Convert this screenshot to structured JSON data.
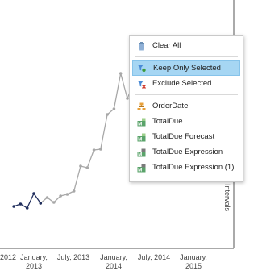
{
  "chart_data": {
    "type": "line",
    "x_ticks": [
      {
        "lines": [
          "2012"
        ]
      },
      {
        "lines": [
          "January,",
          "2013"
        ]
      },
      {
        "lines": [
          "July, 2013"
        ]
      },
      {
        "lines": [
          "January,",
          "2014"
        ]
      },
      {
        "lines": [
          "July, 2014"
        ]
      },
      {
        "lines": [
          "January,",
          "2015"
        ]
      }
    ],
    "side_label": "Intervals",
    "series_selected": [
      {
        "x": "2012-10",
        "y": 11.2
      },
      {
        "x": "2012-11",
        "y": 11.5
      },
      {
        "x": "2012-12",
        "y": 11.0
      },
      {
        "x": "2013-01",
        "y": 12.8
      },
      {
        "x": "2013-02",
        "y": 11.6
      }
    ],
    "series_other": [
      {
        "x": "2013-02",
        "y": 11.6
      },
      {
        "x": "2013-03",
        "y": 12.3
      },
      {
        "x": "2013-04",
        "y": 11.7
      },
      {
        "x": "2013-05",
        "y": 12.5
      },
      {
        "x": "2013-06",
        "y": 12.7
      },
      {
        "x": "2013-07",
        "y": 13.1
      },
      {
        "x": "2013-08",
        "y": 16.2
      },
      {
        "x": "2013-09",
        "y": 16.0
      },
      {
        "x": "2013-10",
        "y": 18.2
      },
      {
        "x": "2013-11",
        "y": 18.3
      },
      {
        "x": "2013-12",
        "y": 22.6
      },
      {
        "x": "2014-01",
        "y": 23.3
      },
      {
        "x": "2014-02",
        "y": 27.7
      },
      {
        "x": "2014-03",
        "y": 24.6
      },
      {
        "x": "2014-04",
        "y": 26.6
      },
      {
        "x": "2014-05",
        "y": 24.3
      },
      {
        "x": "2014-06",
        "y": 28.0
      }
    ],
    "colors": {
      "selected": "#1f2d5c",
      "other": "#a8a8a8",
      "axis": "#555555"
    }
  },
  "context_menu": {
    "items": [
      {
        "label": "Clear All",
        "icon": "trash-icon"
      },
      {
        "separator": true
      },
      {
        "label": "Keep Only Selected",
        "icon": "keep-filter-icon",
        "highlighted": true
      },
      {
        "label": "Exclude Selected",
        "icon": "exclude-filter-icon"
      },
      {
        "separator": true
      },
      {
        "label": "OrderDate",
        "icon": "hierarchy-icon"
      },
      {
        "label": "TotalDue",
        "icon": "measure-icon"
      },
      {
        "label": "TotalDue Forecast",
        "icon": "measure-icon"
      },
      {
        "label": "TotalDue Expression",
        "icon": "measure-calc-icon"
      },
      {
        "label": "TotalDue Expression (1)",
        "icon": "measure-calc-icon"
      }
    ]
  }
}
